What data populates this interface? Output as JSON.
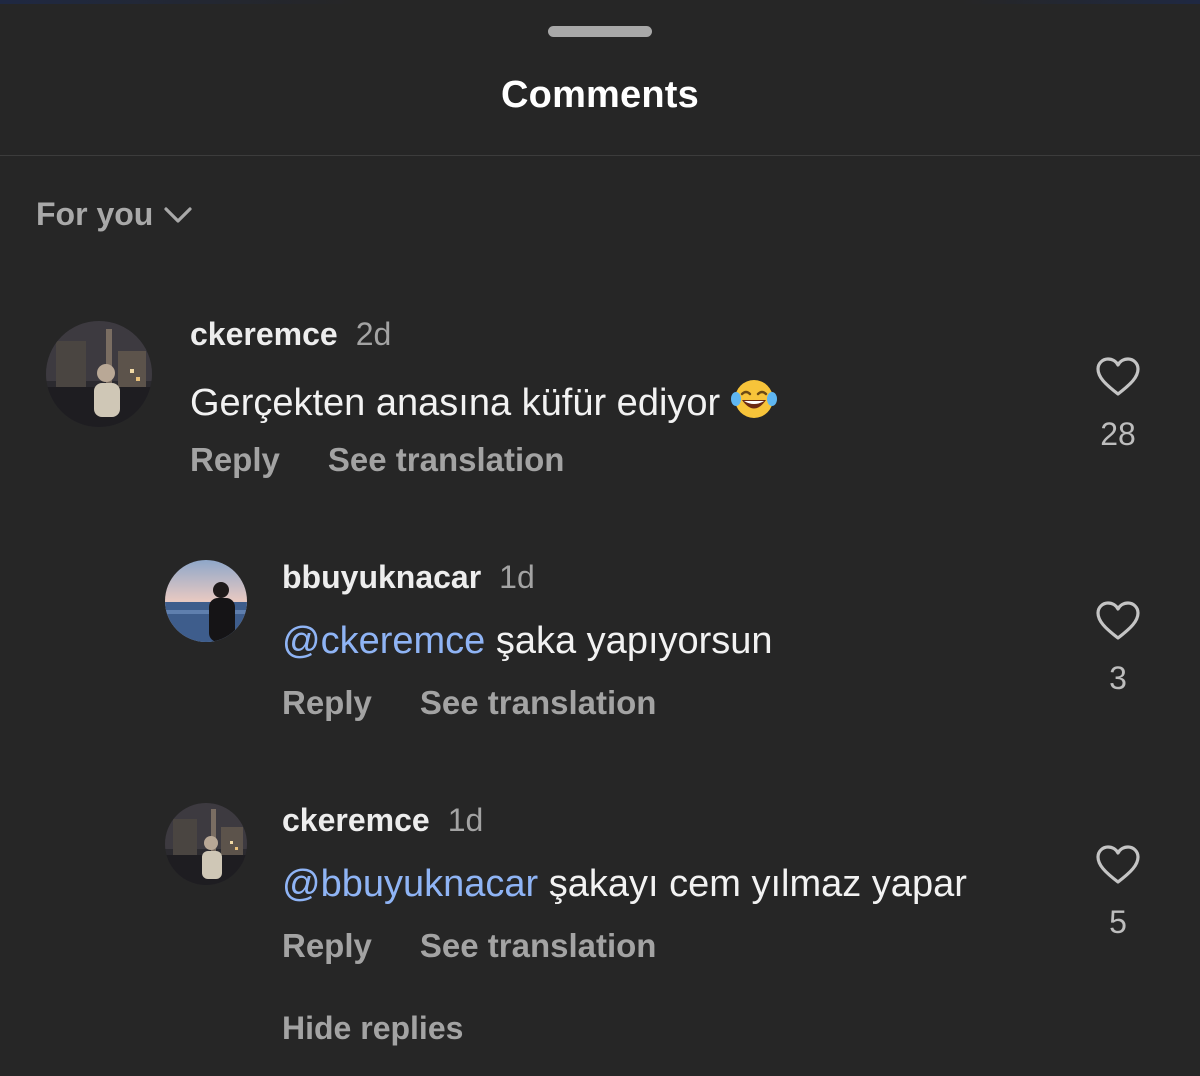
{
  "header": {
    "title": "Comments"
  },
  "sort": {
    "label": "For you",
    "icon": "chevron-down-icon"
  },
  "comments": [
    {
      "username": "ckeremce",
      "time": "2d",
      "mention": "",
      "text": "Gerçekten anasına küfür ediyor",
      "emoji": "face-with-tears-of-joy",
      "reply_label": "Reply",
      "translate_label": "See translation",
      "likes": "28"
    },
    {
      "username": "bbuyuknacar",
      "time": "1d",
      "mention": "@ckeremce",
      "text": " şaka yapıyorsun",
      "reply_label": "Reply",
      "translate_label": "See translation",
      "likes": "3"
    },
    {
      "username": "ckeremce",
      "time": "1d",
      "mention": "@bbuyuknacar",
      "text": " şakayı cem yılmaz yapar",
      "reply_label": "Reply",
      "translate_label": "See translation",
      "likes": "5"
    }
  ],
  "thread": {
    "hide_replies_label": "Hide replies"
  },
  "colors": {
    "background": "#262626",
    "mention": "#8fb4f5",
    "secondary_text": "#a3a3a3"
  }
}
